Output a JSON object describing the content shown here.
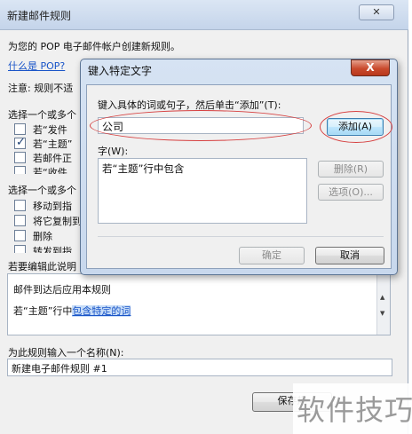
{
  "window": {
    "title": "新建邮件规则",
    "close_glyph": "✕",
    "intro": "为您的 POP 电子邮件帐户创建新规则。",
    "what_is_pop_link": "什么是 POP?",
    "note": "注意: 规则不适",
    "conditions_heading": "选择一个或多个",
    "conditions": [
      {
        "label": "若“发件",
        "checked": false
      },
      {
        "label": "若“主题”",
        "checked": true
      },
      {
        "label": "若邮件正",
        "checked": false
      },
      {
        "label": "若“收件",
        "checked": false
      }
    ],
    "actions_heading": "选择一个或多个",
    "actions": [
      {
        "label": "移动到指",
        "checked": false
      },
      {
        "label": "将它复制到",
        "checked": false
      },
      {
        "label": "删除",
        "checked": false
      },
      {
        "label": "转发到指",
        "checked": false
      }
    ],
    "edit_heading": "若要编辑此说明",
    "description": {
      "line1": "邮件到达后应用本规则",
      "line2_prefix": "若“主题”行中",
      "line2_link": "包含特定的词"
    },
    "name_label": "为此规则输入一个名称(N):",
    "name_value": "新建电子邮件规则 #1",
    "save_button": "保存规"
  },
  "dialog": {
    "title": "键入特定文字",
    "close_glyph": "X",
    "instruction": "键入具体的词或句子，然后单击“添加”(T):",
    "phrase_value": "公司",
    "add_button": "添加(A)",
    "words_label": "字(W):",
    "words": [
      "若“主题”行中包含"
    ],
    "remove_button": "删除(R)",
    "options_button": "选项(O)...",
    "ok_button": "确定",
    "cancel_button": "取消"
  },
  "watermark": "软件技巧",
  "colors": {
    "link": "#1a55c8",
    "highlight_oval": "#d64040",
    "dialog_close": "#c94a2d"
  }
}
